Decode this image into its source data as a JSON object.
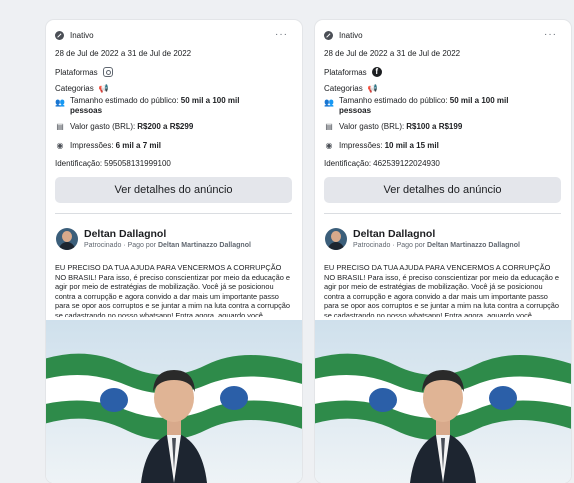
{
  "cards": [
    {
      "status": "Inativo",
      "more": "···",
      "dates": "28 de Jul de 2022 a 31 de Jul de 2022",
      "platforms_label": "Plataformas",
      "categories_label": "Categorias",
      "audience_label": "Tamanho estimado do público:",
      "audience_value_1": "50 mil a 100 mil",
      "audience_value_2": "pessoas",
      "spend_label": "Valor gasto (BRL):",
      "spend_value": "R$200 a R$299",
      "impressions_label": "Impressões:",
      "impressions_value": "6 mil a 7 mil",
      "id_label": "Identificação:",
      "id_value": "595058131999100",
      "details_button": "Ver detalhes do anúncio",
      "advertiser": "Deltan Dallagnol",
      "sponsored": "Patrocinado · Pago por",
      "paid_by": "Deltan Martinazzo Dallagnol",
      "ad_text": "EU PRECISO DA TUA AJUDA PARA VENCERMOS A CORRUPÇÃO NO BRASIL! Para isso, é preciso conscientizar por meio da educação e agir por meio de estratégias de mobilização. Você já se posicionou contra a corrupção e agora convido a dar mais um importante passo para se opor aos corruptos e se juntar a mim na luta contra a corrupção se cadastrando no nosso whatsapp! Entra agora, aguardo você,"
    },
    {
      "status": "Inativo",
      "more": "···",
      "dates": "28 de Jul de 2022 a 31 de Jul de 2022",
      "platforms_label": "Plataformas",
      "categories_label": "Categorias",
      "audience_label": "Tamanho estimado do público:",
      "audience_value_1": "50 mil a 100 mil",
      "audience_value_2": "pessoas",
      "spend_label": "Valor gasto (BRL):",
      "spend_value": "R$100 a R$199",
      "impressions_label": "Impressões:",
      "impressions_value": "10 mil a 15 mil",
      "id_label": "Identificação:",
      "id_value": "462539122024930",
      "details_button": "Ver detalhes do anúncio",
      "advertiser": "Deltan Dallagnol",
      "sponsored": "Patrocinado · Pago por",
      "paid_by": "Deltan Martinazzo Dallagnol",
      "ad_text": "EU PRECISO DA TUA AJUDA PARA VENCERMOS A CORRUPÇÃO NO BRASIL! Para isso, é preciso conscientizar por meio da educação e agir por meio de estratégias de mobilização. Você já se posicionou contra a corrupção e agora convido a dar mais um importante passo para se opor aos corruptos e se juntar a mim na luta contra a corrupção se cadastrando no nosso whatsapp! Entra agora, aguardo você,"
    }
  ],
  "icons": {
    "status": "check-circle-icon",
    "more": "ellipsis-icon",
    "platform_card1": "instagram-icon",
    "platform_card2": "facebook-icon",
    "category": "megaphone-icon",
    "audience": "people-icon",
    "spend": "money-icon",
    "impressions": "eye-icon"
  },
  "colors": {
    "page_bg": "#eef0f3",
    "card_bg": "#ffffff",
    "button_bg": "#e4e6eb",
    "flag_green": "#2e8b4a"
  }
}
